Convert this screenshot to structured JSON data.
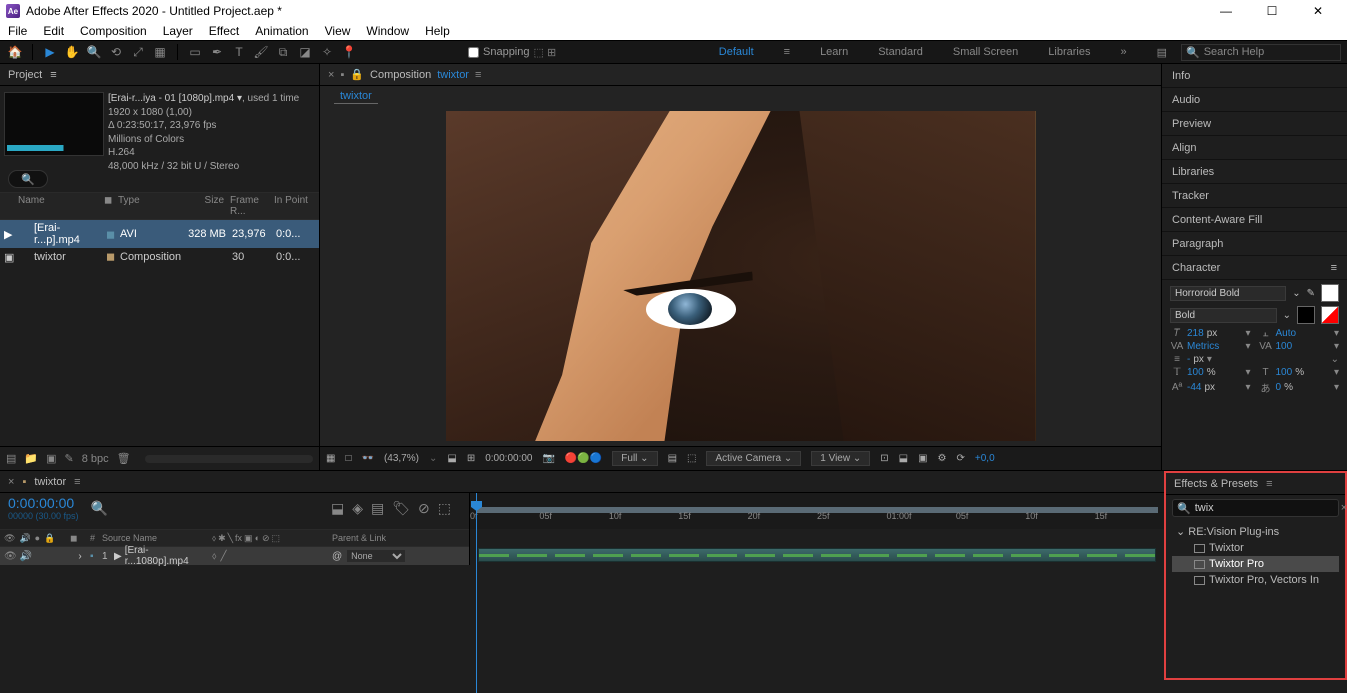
{
  "titlebar": {
    "app": "Adobe After Effects 2020",
    "doc": "Untitled Project.aep *",
    "logo": "Ae"
  },
  "menu": [
    "File",
    "Edit",
    "Composition",
    "Layer",
    "Effect",
    "Animation",
    "View",
    "Window",
    "Help"
  ],
  "toolbar": {
    "snapping": "Snapping"
  },
  "workspaces": {
    "items": [
      "Default",
      "Learn",
      "Standard",
      "Small Screen",
      "Libraries"
    ],
    "active": "Default"
  },
  "searchhelp": {
    "placeholder": "Search Help"
  },
  "project": {
    "tab": "Project",
    "meta": {
      "name": "[Erai-r...iya - 01 [1080p].mp4 ▾",
      "used": ", used 1 time",
      "dims": "1920 x 1080 (1,00)",
      "dur": "Δ 0:23:50:17, 23,976 fps",
      "colors": "Millions of Colors",
      "codec": "H.264",
      "audio": "48,000 kHz / 32 bit U / Stereo"
    },
    "cols": {
      "name": "Name",
      "type": "Type",
      "size": "Size",
      "fr": "Frame R...",
      "in": "In Point"
    },
    "rows": [
      {
        "name": "[Erai-r...p].mp4",
        "type": "AVI",
        "size": "328 MB",
        "fr": "23,976",
        "in": "0:0...",
        "sel": true,
        "kind": "vid"
      },
      {
        "name": "twixtor",
        "type": "Composition",
        "size": "",
        "fr": "30",
        "in": "0:0...",
        "sel": false,
        "kind": "comp"
      }
    ],
    "footer_bpc": "8 bpc"
  },
  "comp": {
    "label": "Composition",
    "name": "twixtor",
    "crumb": "twixtor"
  },
  "viewerbar": {
    "zoom": "(43,7%)",
    "time": "0:00:00:00",
    "res": "Full",
    "camera": "Active Camera",
    "views": "1 View",
    "exp": "+0,0"
  },
  "rightpanels": [
    "Info",
    "Audio",
    "Preview",
    "Align",
    "Libraries",
    "Tracker",
    "Content-Aware Fill",
    "Paragraph"
  ],
  "character": {
    "title": "Character",
    "font": "Horroroid Bold",
    "style": "Bold",
    "size": "218",
    "size_u": "px",
    "leading": "Auto",
    "kerning": "Metrics",
    "tracking": "100",
    "stroke": "-",
    "stroke_u": "px",
    "vscale": "100",
    "vscale_u": "%",
    "hscale": "100",
    "hscale_u": "%",
    "baseline": "-44",
    "baseline_u": "px",
    "tsume": "0",
    "tsume_u": "%"
  },
  "timeline": {
    "tab": "twixtor",
    "time": "0:00:00:00",
    "sub": "00000 (30.00 fps)",
    "ruler": [
      "0f",
      "05f",
      "10f",
      "15f",
      "20f",
      "25f",
      "01:00f",
      "05f",
      "10f",
      "15f"
    ],
    "cols": {
      "src": "Source Name",
      "parent": "Parent & Link"
    },
    "row": {
      "num": "1",
      "name": "[Erai-r...1080p].mp4",
      "parent": "None"
    }
  },
  "effects": {
    "title": "Effects & Presets",
    "query": "twix",
    "group": "RE:Vision Plug-ins",
    "items": [
      "Twixtor",
      "Twixtor Pro",
      "Twixtor Pro, Vectors In"
    ],
    "selected": "Twixtor Pro"
  }
}
